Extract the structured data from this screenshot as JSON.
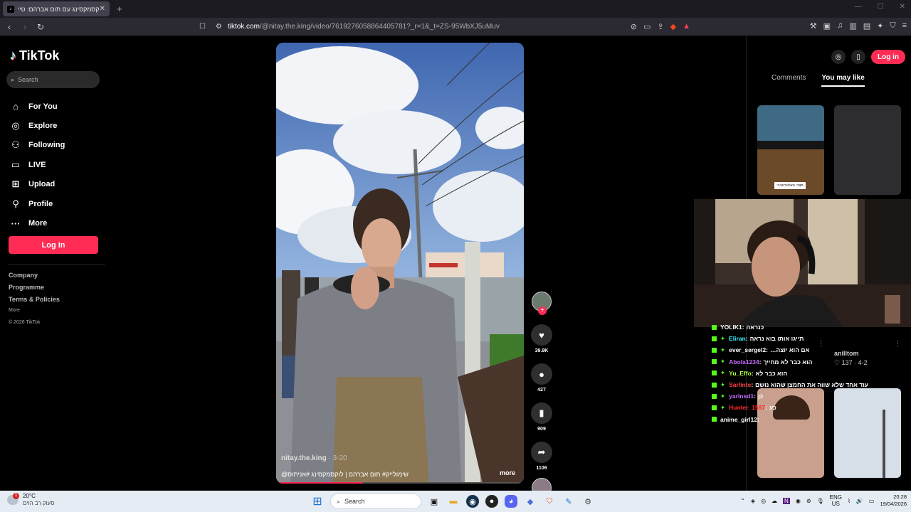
{
  "browser": {
    "tab_title": "לוקסמקסינג עם תום אברהם: טיי",
    "tab_close": "✕",
    "new_tab": "+",
    "url_host": "tiktok.com",
    "url_path": "/@nitay.the.king/video/7619276058864405781?_r=1&_t=ZS-95WbXJ5uMuv",
    "window_controls": [
      "—",
      "☐",
      "✕"
    ]
  },
  "sidebar": {
    "logo": "TikTok",
    "search_placeholder": "Search",
    "nav": [
      {
        "label": "For You",
        "icon": "home-icon"
      },
      {
        "label": "Explore",
        "icon": "compass-icon"
      },
      {
        "label": "Following",
        "icon": "following-icon"
      },
      {
        "label": "LIVE",
        "icon": "live-icon"
      },
      {
        "label": "Upload",
        "icon": "upload-icon"
      },
      {
        "label": "Profile",
        "icon": "profile-icon"
      },
      {
        "label": "More",
        "icon": "more-icon"
      }
    ],
    "login": "Log in",
    "footer": [
      "Company",
      "Programme",
      "Terms & Policies"
    ],
    "footer_more": "More",
    "copyright": "© 2026 TikTok"
  },
  "video": {
    "username": "nitay.the.king",
    "date": "· 3-20",
    "caption": "שימולייק#  תום אברהם | לוקסמקסינג #אניתוס@",
    "more": "more",
    "progress": 0.35
  },
  "actions": {
    "likes": "39.9K",
    "comments": "427",
    "saves": "909",
    "shares": "1106"
  },
  "right_panel": {
    "login": "Log in",
    "tab_comments": "Comments",
    "tab_you_may_like": "You may like",
    "thumb_overlay_text": "מצבי האלטרנטיבי",
    "rec_author": "anilltom",
    "rec_stats": "♡ 137 · 4-2"
  },
  "stream_chat": [
    {
      "user": "YOLIK1",
      "color": "#ffffff",
      "msg": "כנראה",
      "badge": "k"
    },
    {
      "user": "Eliran",
      "color": "#3ef0ff",
      "msg": "תייגו אותו בוא נראה",
      "badge": "k"
    },
    {
      "user": "ever_sergel2",
      "color": "#ffffff",
      "msg": "אם הוא יוצה…",
      "badge": "k"
    },
    {
      "user": "Abola1234",
      "color": "#c66bff",
      "msg": "הוא כבר לא מחייך",
      "badge": "k"
    },
    {
      "user": "Yu_Effo",
      "color": "#b4ff3b",
      "msg": "הוא כבר לא",
      "badge": "k"
    },
    {
      "user": "Sarlinte",
      "color": "#ff4141",
      "msg": "עוד אחד שלא שווה את החמצן שהוא נושם",
      "badge": "k"
    },
    {
      "user": "yarinsd1",
      "color": "#c66bff",
      "msg": "כן",
      "badge": "k"
    },
    {
      "user": "Hunter_1597",
      "color": "#ff2a2a",
      "msg": "כע",
      "badge": "k"
    },
    {
      "user": "anime_girl12",
      "color": "#ffffff",
      "msg": "",
      "badge": "k"
    }
  ],
  "taskbar": {
    "temp": "20°C",
    "weather_desc": "סעוק רב הוים",
    "weather_badge": "1",
    "search": "Search",
    "lang": "ENG",
    "region": "US",
    "time": "20:28",
    "date": "19/04/2026"
  },
  "colors": {
    "accent": "#fe2c55",
    "kick_green": "#53fc18"
  }
}
